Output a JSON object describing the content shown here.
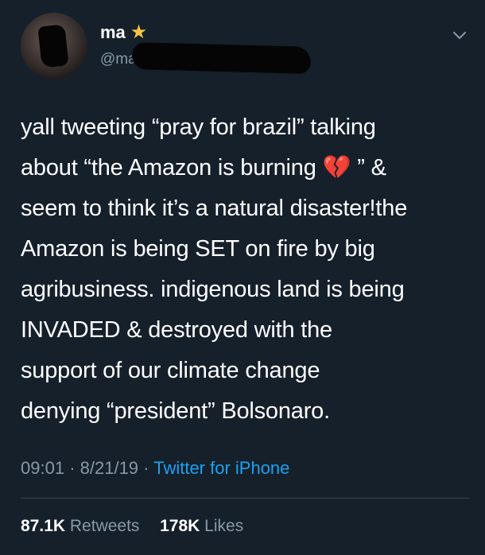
{
  "user": {
    "display_name": "ma",
    "handle": "@ma"
  },
  "tweet": {
    "lines": [
      "yall tweeting “pray for brazil” talking",
      "about “the Amazon is burning",
      "seem to think it’s a natural disaster!the",
      "Amazon is being SET on fire by big",
      "agribusiness. indigenous land is being",
      "INVADED & destroyed with the",
      "support of our climate change",
      "denying “president” Bolsonaro."
    ],
    "line2_suffix": " ” &",
    "heart_emoji": "💔"
  },
  "meta": {
    "time": "09:01",
    "date": "8/21/19",
    "separator": "·",
    "source": "Twitter for iPhone"
  },
  "stats": {
    "retweets_count": "87.1K",
    "retweets_label": "Retweets",
    "likes_count": "178K",
    "likes_label": "Likes"
  },
  "colors": {
    "background": "#15202b",
    "secondary_text": "#8899a6",
    "link": "#1da1f2",
    "divider": "#38444d",
    "verified_star": "#f6c343"
  }
}
